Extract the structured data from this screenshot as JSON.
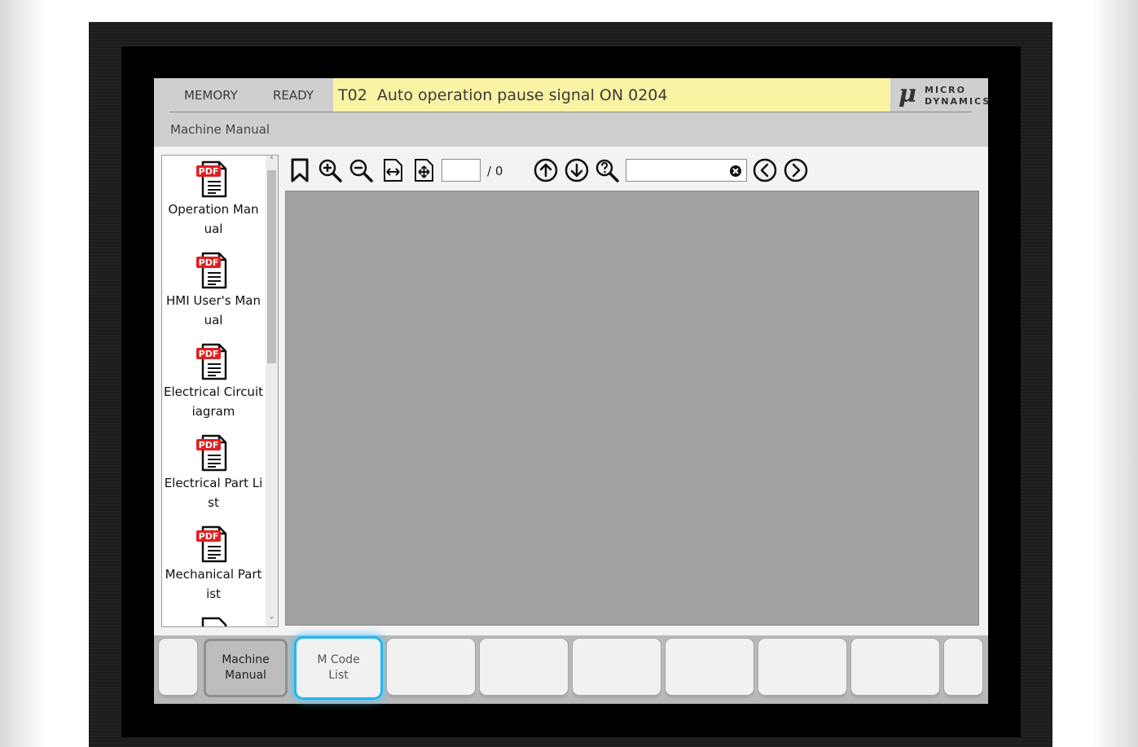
{
  "status": {
    "mode": "MEMORY",
    "state": "READY",
    "alarm": "T02  Auto operation pause signal ON 0204"
  },
  "logo": {
    "symbol": "μ",
    "line1": "MICRO",
    "line2": "DYNAMICS"
  },
  "screen_title": "Machine Manual",
  "files": [
    {
      "name": "Operation Manual",
      "label": "Operation Man\nual",
      "icon": "pdf-file-icon"
    },
    {
      "name": "HMI User's Manual",
      "label": "HMI User's Man\nual",
      "icon": "pdf-file-icon"
    },
    {
      "name": "Electrical Circuit Diagram",
      "label": "Electrical Circuit\niagram",
      "icon": "pdf-file-icon"
    },
    {
      "name": "Electrical Part List",
      "label": "Electrical Part Li\nst",
      "icon": "pdf-file-icon"
    },
    {
      "name": "Mechanical Part List",
      "label": "Mechanical Part\nist",
      "icon": "pdf-file-icon"
    }
  ],
  "viewer": {
    "page_value": "",
    "page_total": "/ 0",
    "search_value": ""
  },
  "softkeys": {
    "machine_manual": "Machine\nManual",
    "mcode_list": "M Code\nList"
  },
  "colors": {
    "alarm_bg": "#fbf3a4",
    "focus_glow": "#24b6f0",
    "pdf_red": "#e02020"
  }
}
